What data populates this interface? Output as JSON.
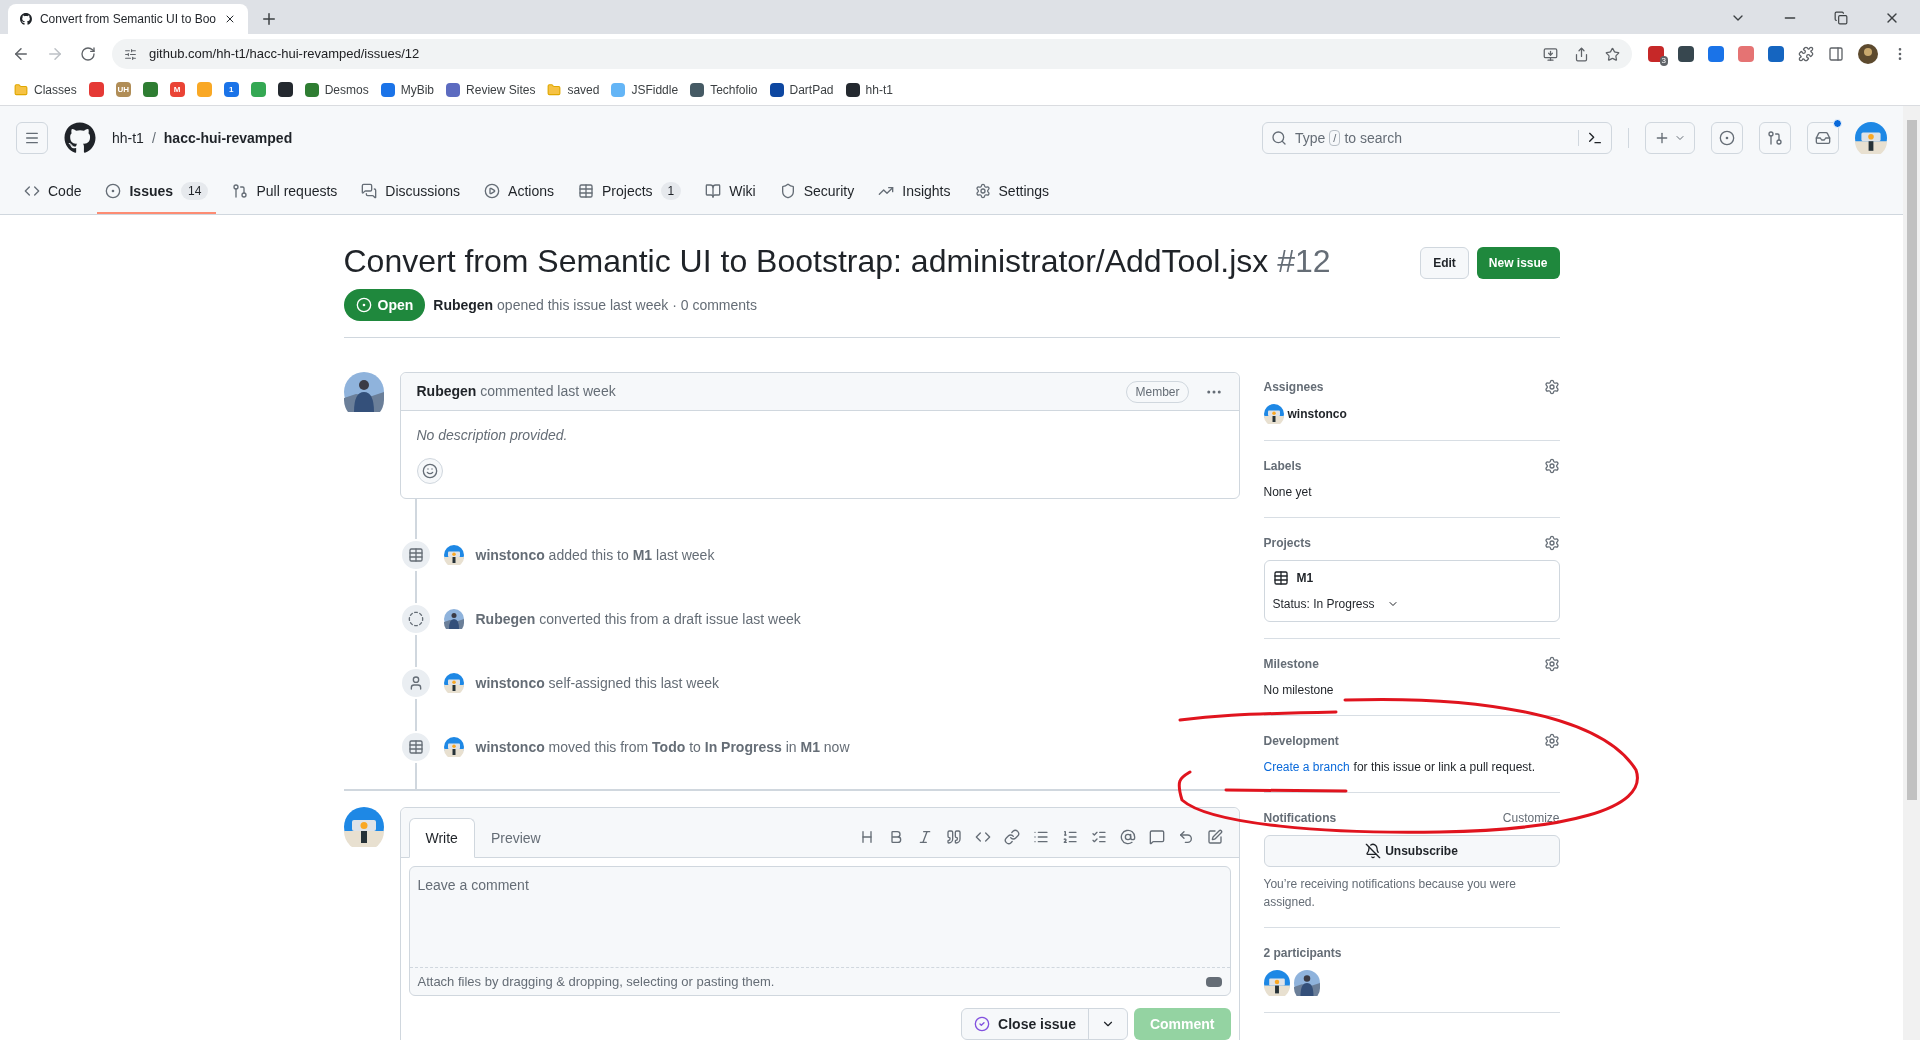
{
  "browser": {
    "tab_title": "Convert from Semantic UI to Boo",
    "url": "github.com/hh-t1/hacc-hui-revamped/issues/12",
    "bookmarks": [
      {
        "kind": "folder",
        "label": "Classes"
      },
      {
        "kind": "icon",
        "color": "#e53935"
      },
      {
        "kind": "icon",
        "color": "#b08d57",
        "glyph": "UH"
      },
      {
        "kind": "icon",
        "color": "#2e7d32"
      },
      {
        "kind": "icon",
        "color": "#ea4335",
        "glyph": "M"
      },
      {
        "kind": "icon",
        "color": "#f9a825"
      },
      {
        "kind": "icon",
        "color": "#1a73e8",
        "glyph": "1"
      },
      {
        "kind": "icon",
        "color": "#34a853"
      },
      {
        "kind": "icon",
        "color": "#24292f"
      },
      {
        "kind": "site",
        "color": "#2e7d32",
        "label": "Desmos"
      },
      {
        "kind": "site",
        "color": "#1a73e8",
        "label": "MyBib"
      },
      {
        "kind": "site",
        "color": "#5c6bc0",
        "label": "Review Sites"
      },
      {
        "kind": "folder",
        "label": "saved"
      },
      {
        "kind": "site",
        "color": "#64b5f6",
        "label": "JSFiddle"
      },
      {
        "kind": "site",
        "color": "#455a64",
        "label": "Techfolio"
      },
      {
        "kind": "site",
        "color": "#0d47a1",
        "label": "DartPad"
      },
      {
        "kind": "site",
        "color": "#24292f",
        "label": "hh-t1"
      }
    ],
    "extensions": [
      {
        "color": "#c62828",
        "badge": "3"
      },
      {
        "color": "#37474f"
      },
      {
        "color": "#1a73e8"
      },
      {
        "color": "#e57373"
      },
      {
        "color": "#1565c0"
      }
    ]
  },
  "header": {
    "owner": "hh-t1",
    "separator": "/",
    "repo": "hacc-hui-revamped",
    "search": {
      "prefix": "Type",
      "key": "/",
      "suffix": "to search"
    },
    "unread_notifications": true
  },
  "repo_nav": [
    {
      "label": "Code",
      "selected": false
    },
    {
      "label": "Issues",
      "count": "14",
      "selected": true
    },
    {
      "label": "Pull requests",
      "selected": false
    },
    {
      "label": "Discussions",
      "selected": false
    },
    {
      "label": "Actions",
      "selected": false
    },
    {
      "label": "Projects",
      "count": "1",
      "selected": false
    },
    {
      "label": "Wiki",
      "selected": false
    },
    {
      "label": "Security",
      "selected": false
    },
    {
      "label": "Insights",
      "selected": false
    },
    {
      "label": "Settings",
      "selected": false
    }
  ],
  "issue": {
    "title": "Convert from Semantic UI to Bootstrap: administrator/AddTool.jsx",
    "number": "#12",
    "buttons": [
      "Edit",
      "New issue"
    ],
    "state": "Open",
    "author": "Rubegen",
    "meta": "opened this issue last week · 0 comments"
  },
  "comment": {
    "author": "Rubegen",
    "avatar": {
      "kind": "photo"
    },
    "action": "commented last week",
    "badge": "Member",
    "body": "No description provided."
  },
  "timeline": [
    {
      "kind": "project",
      "avatar": {
        "kind": "robot"
      },
      "text": "**winstonco** added this to **M1** last week"
    },
    {
      "kind": "draft",
      "avatar": {
        "kind": "photo"
      },
      "text": "**Rubegen** converted this from a draft issue last week"
    },
    {
      "kind": "assign",
      "avatar": {
        "kind": "robot"
      },
      "text": "**winstonco** self-assigned this last week"
    },
    {
      "kind": "project",
      "avatar": {
        "kind": "robot"
      },
      "text": "**winstonco** moved this from **Todo** to **In Progress** in **M1** now"
    }
  ],
  "composer": {
    "avatar": {
      "kind": "robot"
    },
    "tabs": [
      {
        "label": "Write",
        "selected": true
      },
      {
        "label": "Preview",
        "selected": false
      }
    ],
    "placeholder": "Leave a comment",
    "attach": "Attach files by dragging & dropping, selecting or pasting them.",
    "close_button": "Close issue",
    "submit": {
      "label": "Comment",
      "disabled": true
    }
  },
  "sidebar": {
    "assignees": {
      "heading": "Assignees",
      "users": [
        {
          "name": "winstonco",
          "avatar": {
            "kind": "robot"
          }
        }
      ]
    },
    "labels": {
      "heading": "Labels",
      "empty": "None yet"
    },
    "projects": {
      "heading": "Projects",
      "items": [
        {
          "name": "M1",
          "status": "Status: In Progress"
        }
      ]
    },
    "milestone": {
      "heading": "Milestone",
      "empty": "No milestone"
    },
    "development": {
      "heading": "Development",
      "link": "Create a branch",
      "text": "for this issue or link a pull request."
    },
    "notifications": {
      "heading": "Notifications",
      "action": "Customize",
      "button": "Unsubscribe",
      "note": "You’re receiving notifications because you were assigned."
    },
    "participants": {
      "heading": "2 participants",
      "avatars": [
        {
          "kind": "robot"
        },
        {
          "kind": "photo"
        }
      ]
    }
  }
}
